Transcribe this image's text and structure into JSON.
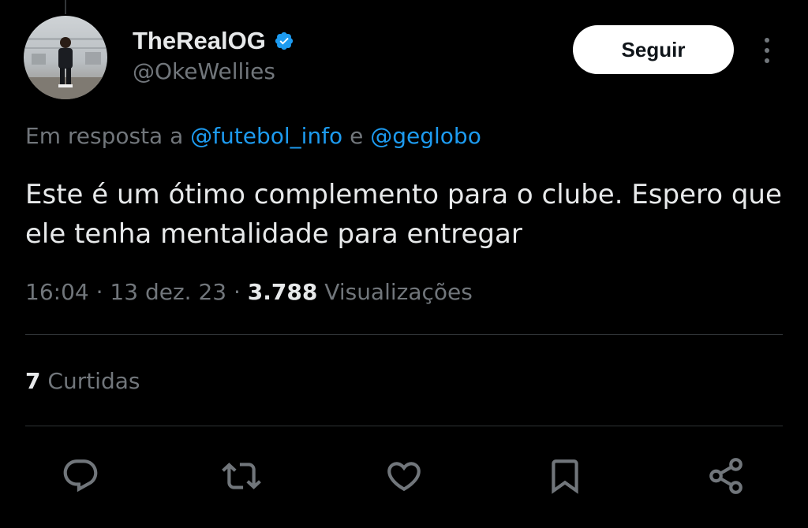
{
  "author": {
    "display_name": "TheRealOG",
    "handle": "@OkeWellies",
    "verified": true
  },
  "follow_button": {
    "label": "Seguir"
  },
  "reply_context": {
    "prefix": "Em resposta a",
    "mention_1": "@futebol_info",
    "joiner": "e",
    "mention_2": "@geglobo"
  },
  "tweet": {
    "text": "Este é um ótimo complemento para o clube. Espero que ele tenha mentalidade para entregar"
  },
  "meta": {
    "time": "16:04",
    "separator": "·",
    "date": "13 dez. 23",
    "views_count": "3.788",
    "views_label": "Visualizações"
  },
  "engagement": {
    "likes_count": "7",
    "likes_label": "Curtidas"
  },
  "actions": [
    "reply-icon",
    "retweet-icon",
    "like-icon",
    "bookmark-icon",
    "share-icon"
  ],
  "colors": {
    "background": "#000000",
    "primary_text": "#e7e9ea",
    "secondary_text": "#71767b",
    "link": "#1d9bf0",
    "verified_badge": "#1d9bf0",
    "divider": "#2f3336",
    "follow_button_bg": "#ffffff"
  }
}
